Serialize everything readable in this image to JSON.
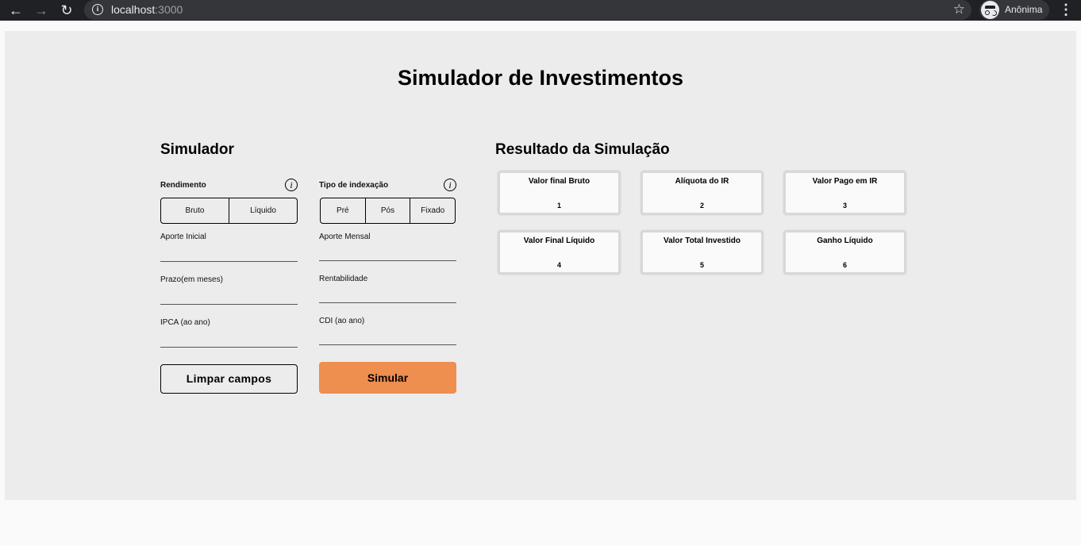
{
  "browser": {
    "url_host": "localhost",
    "url_port": ":3000",
    "profile_name": "Anônima"
  },
  "page": {
    "title": "Simulador de Investimentos"
  },
  "simulator": {
    "title": "Simulador",
    "rendimento_label": "Rendimento",
    "rendimento_options": [
      "Bruto",
      "Líquido"
    ],
    "indexacao_label": "Tipo de indexação",
    "indexacao_options": [
      "Pré",
      "Pós",
      "Fixado"
    ],
    "fields": {
      "aporte_inicial": "Aporte Inicial",
      "aporte_mensal": "Aporte Mensal",
      "prazo": "Prazo(em meses)",
      "rentabilidade": "Rentabilidade",
      "ipca": "IPCA (ao ano)",
      "cdi": "CDI (ao ano)"
    },
    "clear_button": "Limpar campos",
    "simulate_button": "Simular"
  },
  "results": {
    "title": "Resultado da Simulação",
    "cards": [
      {
        "label": "Valor final Bruto",
        "value": "1"
      },
      {
        "label": "Alíquota do IR",
        "value": "2"
      },
      {
        "label": "Valor Pago em IR",
        "value": "3"
      },
      {
        "label": "Valor Final Líquido",
        "value": "4"
      },
      {
        "label": "Valor Total Investido",
        "value": "5"
      },
      {
        "label": "Ganho Líquido",
        "value": "6"
      }
    ]
  }
}
